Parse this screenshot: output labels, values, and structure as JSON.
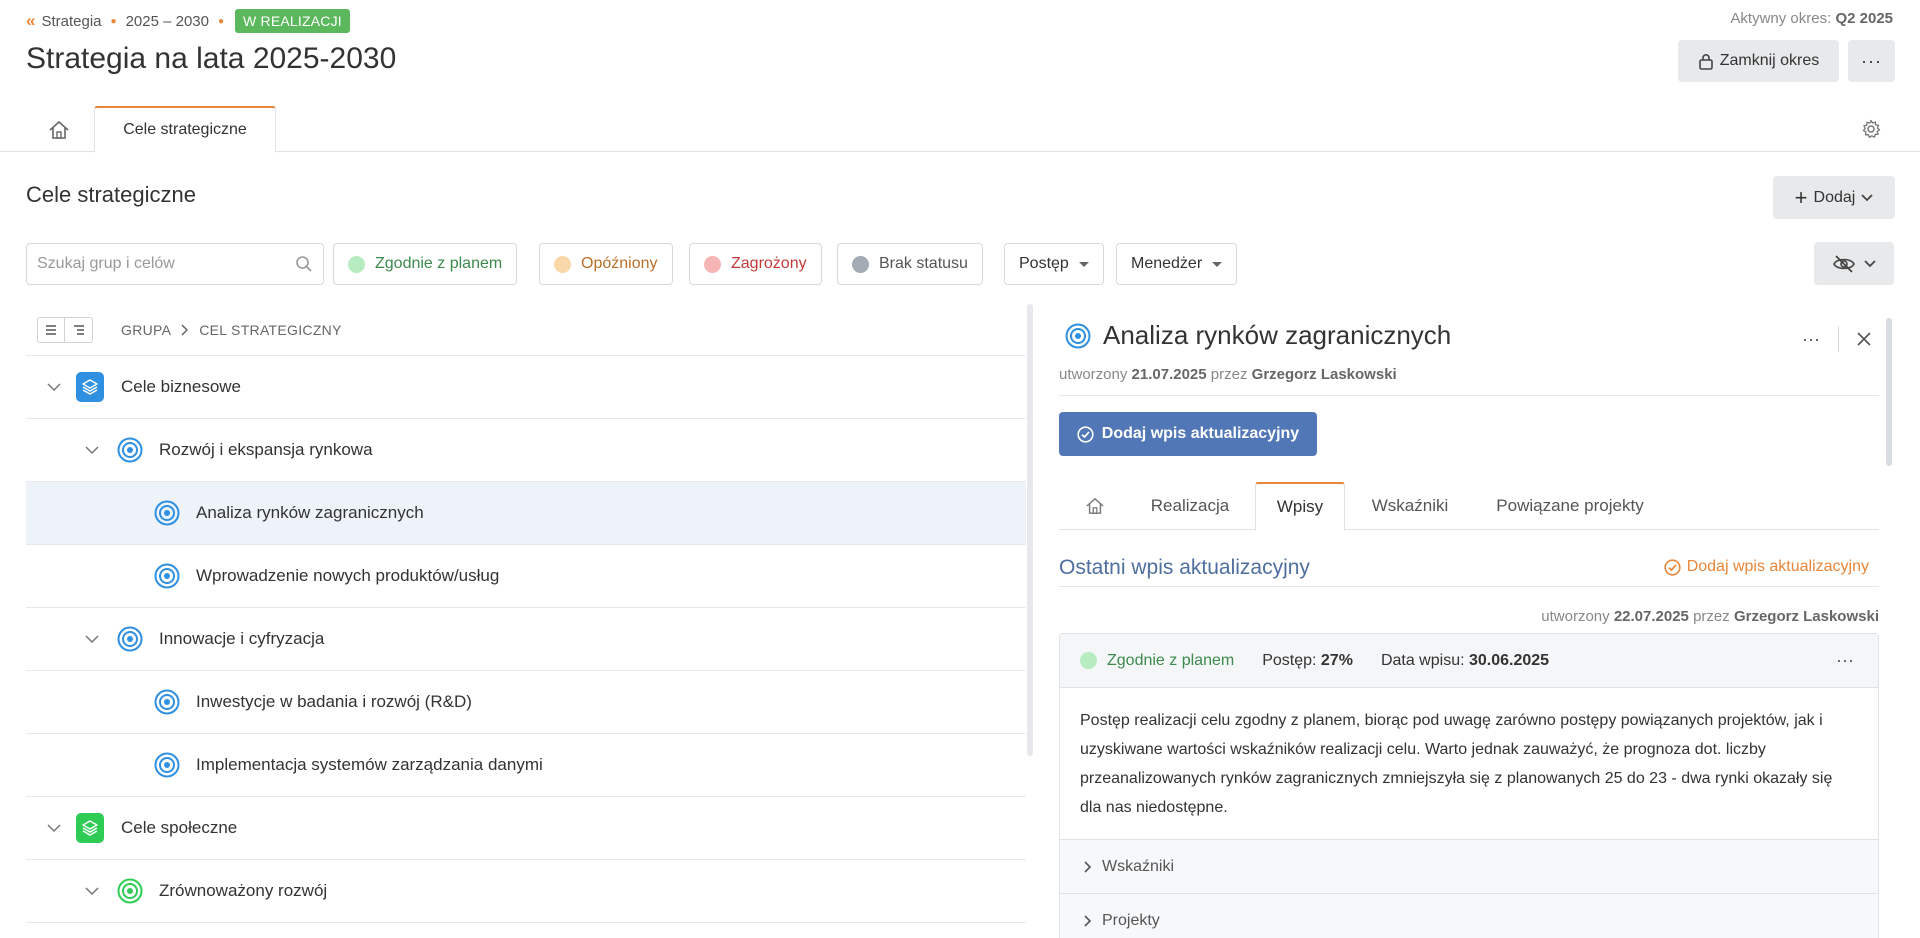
{
  "breadcrumb": {
    "root": "Strategia",
    "period": "2025 – 2030",
    "status": "W REALIZACJI"
  },
  "active_period": {
    "label": "Aktywny okres:",
    "value": "Q2 2025"
  },
  "page_title": "Strategia na lata 2025-2030",
  "header_buttons": {
    "close_period": "Zamknij okres",
    "more": "···"
  },
  "tabs": {
    "active": "Cele strategiczne"
  },
  "section": {
    "title": "Cele strategiczne",
    "add": "Dodaj"
  },
  "filters": {
    "search_placeholder": "Szukaj grup i celów",
    "chips": [
      {
        "label": "Zgodnie z planem",
        "color": "#b6ecc0",
        "text_color": "#3c8a4d"
      },
      {
        "label": "Opóźniony",
        "color": "#f8d8a8",
        "text_color": "#b8702c"
      },
      {
        "label": "Zagrożony",
        "color": "#f5b5b5",
        "text_color": "#c23a3a"
      },
      {
        "label": "Brak statusu",
        "color": "#a3abb5",
        "text_color": "#555555"
      }
    ],
    "progress": "Postęp",
    "manager": "Menedżer"
  },
  "tree": {
    "header": {
      "group": "GRUPA",
      "goal": "CEL STRATEGICZNY"
    },
    "rows": [
      {
        "label": "Cele biznesowe"
      },
      {
        "label": "Rozwój i ekspansja rynkowa"
      },
      {
        "label": "Analiza rynków zagranicznych"
      },
      {
        "label": "Wprowadzenie nowych produktów/usług"
      },
      {
        "label": "Innowacje i cyfryzacja"
      },
      {
        "label": "Inwestycje w badania i rozwój (R&D)"
      },
      {
        "label": "Implementacja systemów zarządzania danymi"
      },
      {
        "label": "Cele społeczne"
      },
      {
        "label": "Zrównoważony rozwój"
      }
    ]
  },
  "detail": {
    "title": "Analiza rynków zagranicznych",
    "created_prefix": "utworzony",
    "created_date": "21.07.2025",
    "created_by_prefix": "przez",
    "created_by": "Grzegorz Laskowski",
    "add_update_button": "Dodaj wpis aktualizacyjny",
    "tabs": [
      "Realizacja",
      "Wpisy",
      "Wskaźniki",
      "Powiązane projekty"
    ],
    "last_entry_title": "Ostatni wpis aktualizacyjny",
    "add_update_link": "Dodaj wpis aktualizacyjny",
    "entry": {
      "created_prefix": "utworzony",
      "created_date": "22.07.2025",
      "created_by_prefix": "przez",
      "created_by": "Grzegorz Laskowski",
      "status": "Zgodnie z planem",
      "progress_label": "Postęp:",
      "progress_value": "27%",
      "date_label": "Data wpisu:",
      "date_value": "30.06.2025",
      "body": "Postęp realizacji celu zgodny z planem, biorąc pod uwagę zarówno postępy powiązanych projektów, jak i uzyskiwane wartości wskaźników realizacji celu. Warto jednak zauważyć, że prognoza dot. liczby przeanalizowanych rynków zagranicznych zmniejszyła się z planowanych 25 do 23 - dwa rynki okazały się dla nas niedostępne.",
      "sections": [
        "Wskaźniki",
        "Projekty"
      ]
    }
  }
}
